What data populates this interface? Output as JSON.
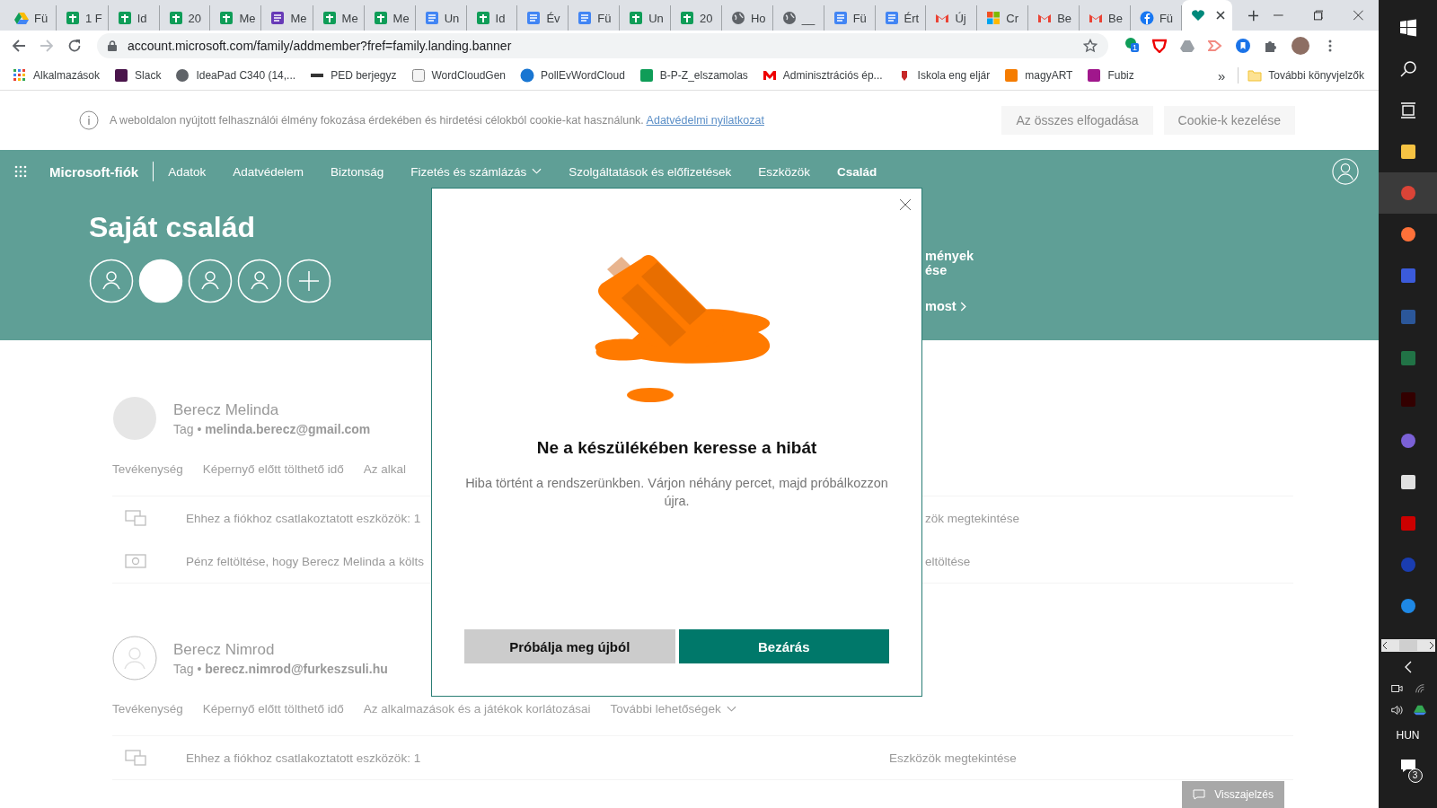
{
  "browser": {
    "tabs": [
      {
        "title": "Fü",
        "kind": "drive",
        "selected": false
      },
      {
        "title": "1 F",
        "kind": "sheets",
        "selected": false
      },
      {
        "title": "Id",
        "kind": "sheets",
        "selected": false
      },
      {
        "title": "20",
        "kind": "sheets",
        "selected": false
      },
      {
        "title": "Me",
        "kind": "sheets",
        "selected": false
      },
      {
        "title": "Me",
        "kind": "forms",
        "selected": false
      },
      {
        "title": "Me",
        "kind": "sheets",
        "selected": false
      },
      {
        "title": "Me",
        "kind": "sheets",
        "selected": false
      },
      {
        "title": "Un",
        "kind": "docs",
        "selected": false
      },
      {
        "title": "Id",
        "kind": "sheets",
        "selected": false
      },
      {
        "title": "Év",
        "kind": "docs",
        "selected": false
      },
      {
        "title": "Fü",
        "kind": "docs",
        "selected": false
      },
      {
        "title": "Un",
        "kind": "sheets",
        "selected": false
      },
      {
        "title": "20",
        "kind": "sheets",
        "selected": false
      },
      {
        "title": "Ho",
        "kind": "globe",
        "selected": false
      },
      {
        "title": "__",
        "kind": "globe",
        "selected": false
      },
      {
        "title": "Fü",
        "kind": "calendar",
        "selected": false
      },
      {
        "title": "Ért",
        "kind": "docs",
        "selected": false
      },
      {
        "title": "Új",
        "kind": "gmail",
        "selected": false
      },
      {
        "title": "Cr",
        "kind": "squares",
        "selected": false
      },
      {
        "title": "Be",
        "kind": "gmail",
        "selected": false
      },
      {
        "title": "Be",
        "kind": "gmail",
        "selected": false
      },
      {
        "title": "Fü",
        "kind": "facebook",
        "selected": false
      },
      {
        "kind": "heart",
        "selected": true
      }
    ],
    "address": "account.microsoft.com/family/addmember?fref=family.landing.banner",
    "extension_badge": "1",
    "bookmarks": [
      {
        "label": "Alkalmazások",
        "kind": "apps"
      },
      {
        "label": "Slack",
        "kind": "slack"
      },
      {
        "label": "IdeaPad C340 (14,...",
        "kind": "globe"
      },
      {
        "label": "PED berjegyz",
        "kind": "dark"
      },
      {
        "label": "WordCloudGen",
        "kind": "j"
      },
      {
        "label": "PollEvWordCloud",
        "kind": "poll"
      },
      {
        "label": "B-P-Z_elszamolas",
        "kind": "sheets"
      },
      {
        "label": "Adminisztrációs ép...",
        "kind": "gmail"
      },
      {
        "label": "Iskola eng eljár",
        "kind": "crest"
      },
      {
        "label": "magyART",
        "kind": "orange"
      },
      {
        "label": "Fubiz",
        "kind": "purple"
      }
    ],
    "bookmarks_more": "»",
    "other_bookmarks": "További könyvjelzők"
  },
  "cookie_banner": {
    "text": "A weboldalon nyújtott felhasználói élmény fokozása érdekében és hirdetési célokból cookie-kat használunk.",
    "link": "Adatvédelmi nyilatkozat",
    "buttons": [
      "Az összes elfogadása",
      "Cookie-k kezelése"
    ]
  },
  "nav": {
    "brand": "Microsoft-fiók",
    "items": [
      {
        "label": "Adatok",
        "selected": false,
        "dropdown": false
      },
      {
        "label": "Adatvédelem",
        "selected": false,
        "dropdown": false
      },
      {
        "label": "Biztonság",
        "selected": false,
        "dropdown": false
      },
      {
        "label": "Fizetés és számlázás",
        "selected": false,
        "dropdown": true
      },
      {
        "label": "Szolgáltatások és előfizetések",
        "selected": false,
        "dropdown": false
      },
      {
        "label": "Eszközök",
        "selected": false,
        "dropdown": false
      },
      {
        "label": "Család",
        "selected": true,
        "dropdown": false
      }
    ]
  },
  "hero": {
    "title": "Saját család",
    "circles": [
      {
        "kind": "person",
        "selected": false
      },
      {
        "kind": "person",
        "selected": true
      },
      {
        "kind": "person",
        "selected": false
      },
      {
        "kind": "person",
        "selected": false
      },
      {
        "kind": "add",
        "selected": false
      }
    ],
    "side_lines": [
      "mények",
      "ése"
    ],
    "side_link": "most"
  },
  "members": [
    {
      "name": "Berecz Melinda",
      "subtitle": "Tag • **melinda.berecz@gmail.com**",
      "kind": "blank",
      "links": [
        {
          "label": "Tevékenység",
          "dropdown": false
        },
        {
          "label": "Képernyő előtt tölthető idő",
          "dropdown": false
        },
        {
          "label": "Az alkal",
          "dropdown": false
        }
      ],
      "rows": [
        {
          "kind": "devices",
          "text": "Ehhez a fiókhoz csatlakoztatott eszközök: 1",
          "action": "zök megtekintése"
        },
        {
          "kind": "money",
          "text": "Pénz feltöltése, hogy Berecz Melinda a költs",
          "action": "eltöltése"
        }
      ]
    },
    {
      "name": "Berecz Nimrod",
      "subtitle": "Tag • **berecz.nimrod@furkeszsuli.hu**",
      "kind": "person",
      "links": [
        {
          "label": "Tevékenység",
          "dropdown": false
        },
        {
          "label": "Képernyő előtt tölthető idő",
          "dropdown": false
        },
        {
          "label": "Az alkalmazások és a játékok korlátozásai",
          "dropdown": false
        },
        {
          "label": "További lehetőségek",
          "dropdown": true
        }
      ],
      "rows": [
        {
          "kind": "devices",
          "text": "Ehhez a fiókhoz csatlakoztatott eszközök: 1",
          "action": "Eszközök megtekintése"
        }
      ]
    }
  ],
  "feedback": "Visszajelzés",
  "dialog": {
    "title": "Ne a készülékében keresse a hibát",
    "message": "Hiba történt a rendszerünkben. Várjon néhány percet, majd próbálkozzon újra.",
    "buttons": [
      {
        "label": "Próbálja meg újból",
        "primary": false
      },
      {
        "label": "Bezárás",
        "primary": true
      }
    ]
  },
  "taskbar": {
    "apps": [
      {
        "kind": "folder",
        "active": false
      },
      {
        "kind": "chrome",
        "active": true
      },
      {
        "kind": "firefox",
        "active": false
      },
      {
        "kind": "floppy",
        "active": false
      },
      {
        "kind": "word",
        "active": false
      },
      {
        "kind": "excel",
        "active": false
      },
      {
        "kind": "illustrator",
        "active": false
      },
      {
        "kind": "bowtie",
        "active": false
      },
      {
        "kind": "acrobat",
        "active": false
      },
      {
        "kind": "red",
        "active": false
      },
      {
        "kind": "audio",
        "active": false
      },
      {
        "kind": "bird",
        "active": false
      }
    ],
    "language": "HUN",
    "notifications": "3"
  }
}
